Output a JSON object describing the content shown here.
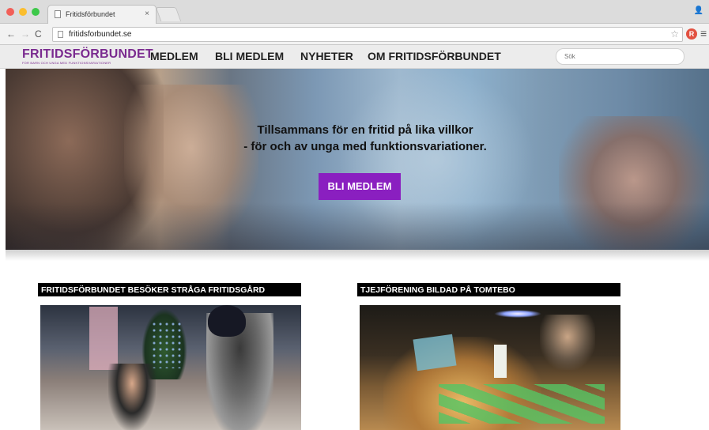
{
  "browser": {
    "tab_title": "Fritidsförbundet",
    "tab_close": "×",
    "url": "fritidsforbundet.se",
    "back_icon": "←",
    "forward_icon": "→",
    "reload_icon": "C",
    "star_icon": "☆",
    "extension_label": "R",
    "menu_icon": "≡",
    "profile_icon": "👤"
  },
  "site": {
    "logo_text": "FRITIDSFÖRBUNDET",
    "logo_tagline": "FÖR BARN OCH UNGA MED FUNKTIONSVARIATIONER",
    "nav": [
      "MEDLEM",
      "BLI MEDLEM",
      "NYHETER",
      "OM FRITIDSFÖRBUNDET"
    ],
    "search_placeholder": "Sök"
  },
  "hero": {
    "line1": "Tillsammans för en fritid på lika villkor",
    "line2": "- för och av unga med funktionsvariationer.",
    "cta": "BLI MEDLEM",
    "cta_color": "#8a1fc0"
  },
  "news": [
    {
      "title": "FRITIDSFÖRBUNDET BESÖKER STRÅGA FRITIDSGÅRD"
    },
    {
      "title": "TJEJFÖRENING BILDAD PÅ TOMTEBO"
    }
  ],
  "colors": {
    "brand": "#7a2a8f",
    "accent": "#8a1fc0"
  }
}
